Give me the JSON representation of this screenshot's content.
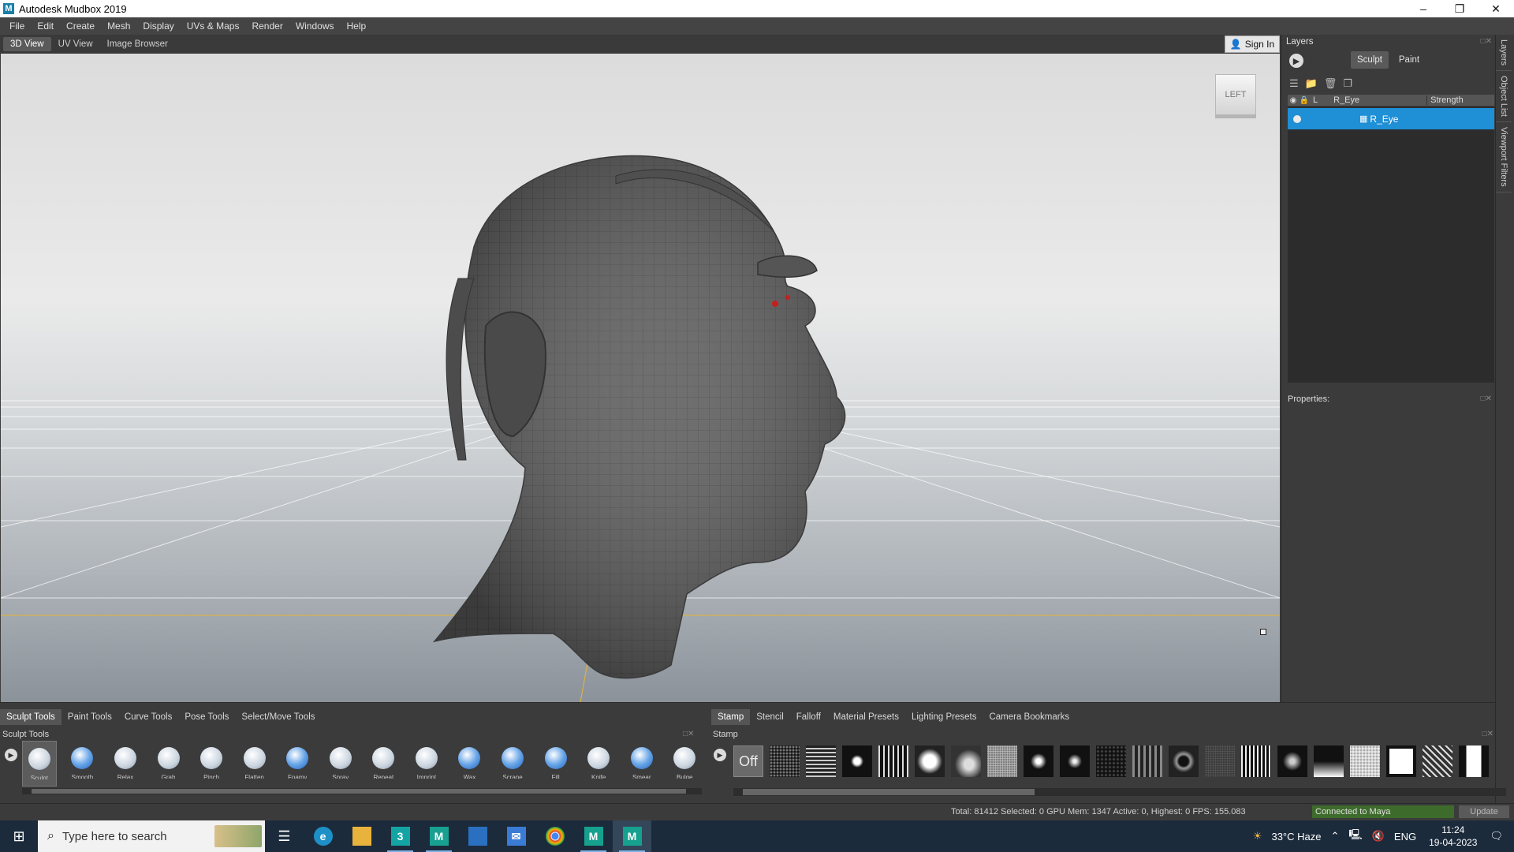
{
  "window": {
    "title": "Autodesk Mudbox 2019",
    "app_icon": "M"
  },
  "menu": [
    "File",
    "Edit",
    "Create",
    "Mesh",
    "Display",
    "UVs & Maps",
    "Render",
    "Windows",
    "Help"
  ],
  "view_tabs": [
    "3D View",
    "UV View",
    "Image Browser"
  ],
  "signin_label": "Sign In",
  "viewcube_label": "LEFT",
  "layers_panel": {
    "title": "Layers",
    "sculpt_tab": "Sculpt",
    "paint_tab": "Paint",
    "header_col1": "L",
    "header_name": "R_Eye",
    "header_strength": "Strength",
    "layer_name": "R_Eye",
    "properties_label": "Properties:"
  },
  "side_tabs": [
    "Layers",
    "Object List",
    "Viewport Filters"
  ],
  "bottom_tabs_left": [
    "Sculpt Tools",
    "Paint Tools",
    "Curve Tools",
    "Pose Tools",
    "Select/Move Tools"
  ],
  "bottom_tabs_right": [
    "Stamp",
    "Stencil",
    "Falloff",
    "Material Presets",
    "Lighting Presets",
    "Camera Bookmarks"
  ],
  "sculpt_tools_label": "Sculpt Tools",
  "stamp_label": "Stamp",
  "stamp_off": "Off",
  "tools": [
    "Sculpt",
    "Smooth",
    "Relax",
    "Grab",
    "Pinch",
    "Flatten",
    "Foamy",
    "Spray",
    "Repeat",
    "Imprint",
    "Wax",
    "Scrape",
    "Fill",
    "Knife",
    "Smear",
    "Bulge"
  ],
  "status": {
    "text": "Total: 81412  Selected: 0 GPU Mem: 1347  Active: 0, Highest: 0  FPS: 155.083",
    "connected": "Connected to Maya",
    "update": "Update"
  },
  "taskbar": {
    "search_placeholder": "Type here to search",
    "weather": "33°C  Haze",
    "language": "ENG",
    "time": "11:24",
    "date": "19-04-2023"
  },
  "colors": {
    "accent": "#1f8fd6",
    "status_green": "#3d6b2b",
    "taskbar": "#1c2b3c"
  }
}
